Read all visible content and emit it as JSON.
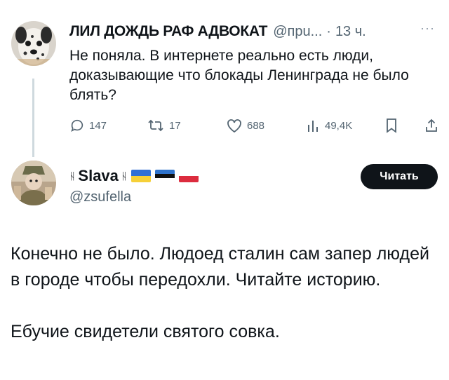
{
  "tweet1": {
    "name": "ЛИЛ ДОЖДЬ РАФ АДВОКАТ",
    "handle": "@пpu...",
    "separator": "·",
    "time": "13 ч.",
    "more": "···",
    "text": "Не поняла. В интернете реально есть люди, доказывающие что блокады Ленинграда не было блять?",
    "actions": {
      "reply_count": "147",
      "repost_count": "17",
      "like_count": "688",
      "views_count": "49,4K"
    }
  },
  "tweet2": {
    "name_prefix": "ᚺ",
    "name": "Slava",
    "name_suffix": "ᚺ",
    "flags": [
      "ukraine-flag",
      "estonia-flag",
      "poland-flag"
    ],
    "handle": "@zsufella",
    "follow_label": "Читать",
    "paragraph1": "Конечно не было. Людоед сталин сам запер людей в городе чтобы передохли. Читайте историю.",
    "paragraph2": "Ебучие свидетели святого совка."
  },
  "colors": {
    "text": "#0f1419",
    "secondary": "#536471",
    "thread_line": "#cfd9de",
    "button_bg": "#0f1419"
  }
}
